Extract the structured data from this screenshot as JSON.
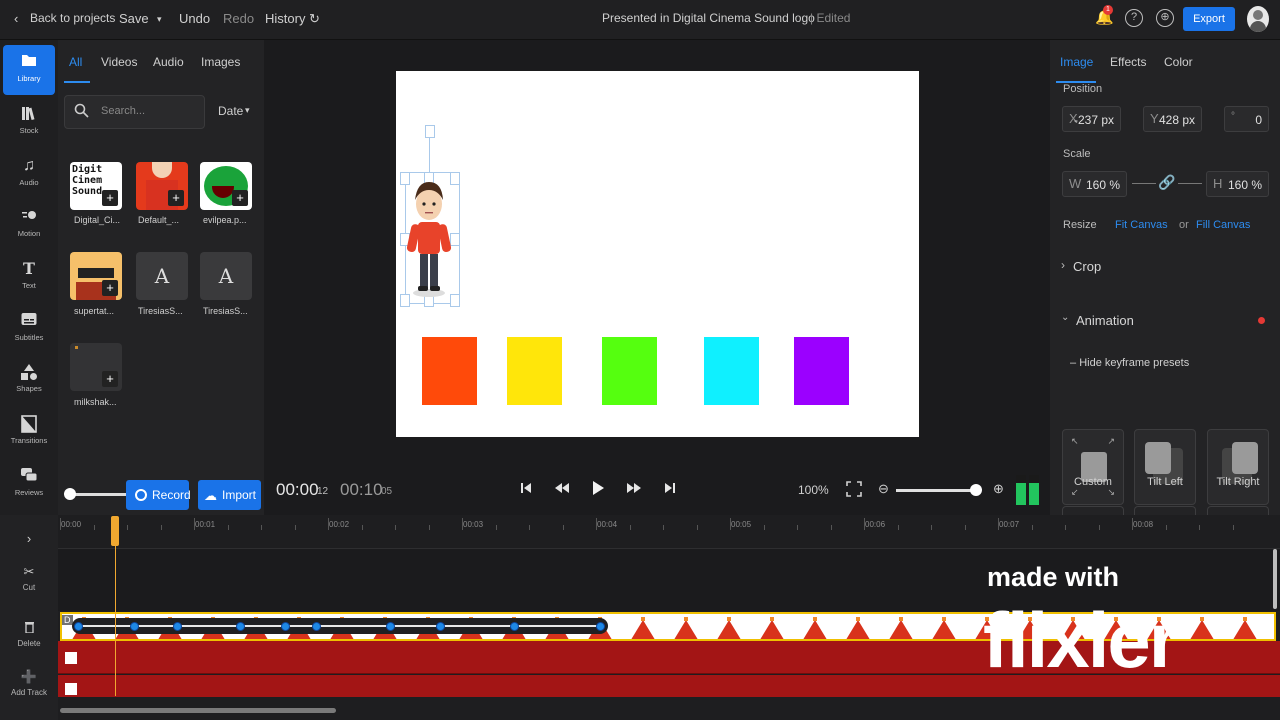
{
  "topbar": {
    "back_label": "Back to projects",
    "save_label": "Save",
    "undo_label": "Undo",
    "redo_label": "Redo",
    "history_label": "History",
    "project_title": "Presented in Digital Cinema Sound logo",
    "edited_status": "| Edited",
    "export_label": "Export",
    "notification_count": "1"
  },
  "rail": {
    "items": [
      {
        "label": "Library",
        "icon": "folder-icon"
      },
      {
        "label": "Stock",
        "icon": "books-icon"
      },
      {
        "label": "Audio",
        "icon": "music-note-icon"
      },
      {
        "label": "Motion",
        "icon": "motion-icon"
      },
      {
        "label": "Text",
        "icon": "text-icon"
      },
      {
        "label": "Subtitles",
        "icon": "subtitles-icon"
      },
      {
        "label": "Shapes",
        "icon": "shapes-icon"
      },
      {
        "label": "Transitions",
        "icon": "transitions-icon"
      },
      {
        "label": "Reviews",
        "icon": "chat-icon"
      }
    ]
  },
  "library": {
    "tabs": [
      "All",
      "Videos",
      "Audio",
      "Images"
    ],
    "search_placeholder": "Search...",
    "sort_label": "Date",
    "assets": [
      {
        "name": "Digital_Ci...",
        "thumb_text": "Digit Cinem Sound"
      },
      {
        "name": "Default_...",
        "thumb_text": ""
      },
      {
        "name": "evilpea.p...",
        "thumb_text": ""
      },
      {
        "name": "supertat...",
        "thumb_text": ""
      },
      {
        "name": "TiresiasS...",
        "thumb_text": "A"
      },
      {
        "name": "TiresiasS...",
        "thumb_text": "A"
      },
      {
        "name": "milkshak...",
        "thumb_text": ""
      }
    ],
    "record_label": "Record",
    "import_label": "Import"
  },
  "player": {
    "current_time": "00:00",
    "current_frames": "12",
    "total_time": "00:10",
    "total_frames": "05",
    "zoom_level": "100%"
  },
  "canvas": {
    "swatch_colors": [
      "#ff4a0a",
      "#ffe60a",
      "#55ff0f",
      "#0ff0ff",
      "#9b00ff"
    ]
  },
  "props": {
    "tabs": [
      "Image",
      "Effects",
      "Color"
    ],
    "position_label": "Position",
    "x_key": "X",
    "x_value": "-237 px",
    "y_key": "Y",
    "y_value": "428 px",
    "rotation_key": "°",
    "rotation_value": "0",
    "scale_label": "Scale",
    "w_key": "W",
    "w_value": "160 %",
    "h_key": "H",
    "h_value": "160 %",
    "resize_label": "Resize",
    "fit_canvas": "Fit Canvas",
    "or_label": "or",
    "fill_canvas": "Fill Canvas",
    "crop_label": "Crop",
    "animation_label": "Animation",
    "hide_presets_label": "Hide keyframe presets",
    "presets": [
      "Custom",
      "Tilt Left",
      "Tilt Right"
    ]
  },
  "timeline": {
    "tools": [
      "Cut",
      "Delete",
      "Add Track"
    ],
    "ticks": [
      "00:00",
      "00:01",
      "00:02",
      "00:03",
      "00:04",
      "00:05",
      "00:06",
      "00:07",
      "00:08"
    ],
    "clip_label": "D",
    "watermark_line1": "made with",
    "watermark_line2": "flixier"
  },
  "colors": {
    "accent": "#1a73e8",
    "link": "#2d8cf0",
    "playhead": "#f0a830",
    "clip_red": "#a31515",
    "clip_border": "#f0c000"
  }
}
